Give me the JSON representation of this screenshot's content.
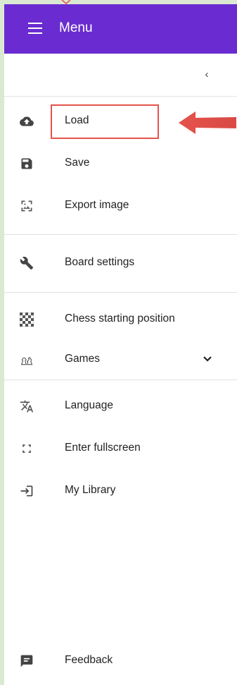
{
  "header": {
    "title": "Menu"
  },
  "collapse": {
    "icon": "chevron-left-icon",
    "glyph": "‹"
  },
  "menu": {
    "load": {
      "label": "Load",
      "icon": "cloud-upload-icon"
    },
    "save": {
      "label": "Save",
      "icon": "floppy-save-icon"
    },
    "export": {
      "label": "Export image",
      "icon": "image-icon"
    },
    "board_settings": {
      "label": "Board settings",
      "icon": "wrench-icon"
    },
    "chess_start": {
      "label": "Chess starting position",
      "icon": "checkerboard-icon"
    },
    "games": {
      "label": "Games",
      "icon": "chess-pieces-icon",
      "expand_icon": "chevron-down-icon"
    },
    "language": {
      "label": "Language",
      "icon": "translate-icon"
    },
    "fullscreen": {
      "label": "Enter fullscreen",
      "icon": "fullscreen-icon"
    },
    "library": {
      "label": "My Library",
      "icon": "login-icon"
    },
    "feedback": {
      "label": "Feedback",
      "icon": "feedback-icon"
    }
  },
  "annotation": {
    "highlight_color": "#e5534b",
    "arrow_color": "#e5534b"
  },
  "colors": {
    "header_bg": "#6a2cd0",
    "page_bg": "#dce9d2"
  }
}
